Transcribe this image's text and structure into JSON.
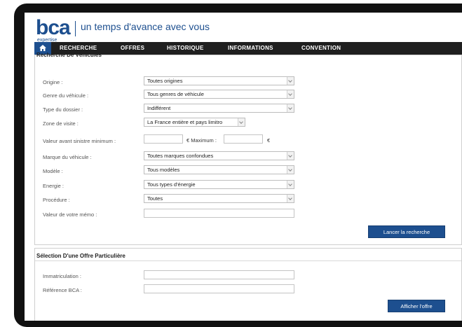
{
  "brand": {
    "logo": "bca",
    "logo_sub": "expertise",
    "tagline": "un temps d'avance avec vous"
  },
  "nav": {
    "items": [
      "RECHERCHE",
      "OFFRES",
      "HISTORIQUE",
      "INFORMATIONS",
      "CONVENTION"
    ]
  },
  "search": {
    "title": "Recherche De Véhicules",
    "origine": {
      "label": "Origine :",
      "value": "Toutes origines"
    },
    "genre": {
      "label": "Genre du véhicule :",
      "value": "Tous genres de véhicule"
    },
    "type_dossier": {
      "label": "Type du dossier :",
      "value": "Indifférent"
    },
    "zone": {
      "label": "Zone de visite :",
      "value": "La France entière et pays limitro"
    },
    "valeur": {
      "label": "Valeur avant sinistre minimum :",
      "max_label": "€ Maximum :",
      "currency": "€"
    },
    "marque": {
      "label": "Marque du véhicule :",
      "value": "Toutes marques confondues"
    },
    "modele": {
      "label": "Modèle :",
      "value": "Tous modèles"
    },
    "energie": {
      "label": "Energie :",
      "value": "Tous types d'énergie"
    },
    "procedure": {
      "label": "Procédure :",
      "value": "Toutes"
    },
    "memo": {
      "label": "Valeur de votre mémo :"
    },
    "submit": "Lancer la recherche"
  },
  "offer": {
    "title": "Sélection D'une Offre Particulière",
    "immat_label": "Immatriculation :",
    "ref_label": "Référence BCA :",
    "submit": "Afficher l'offre"
  }
}
